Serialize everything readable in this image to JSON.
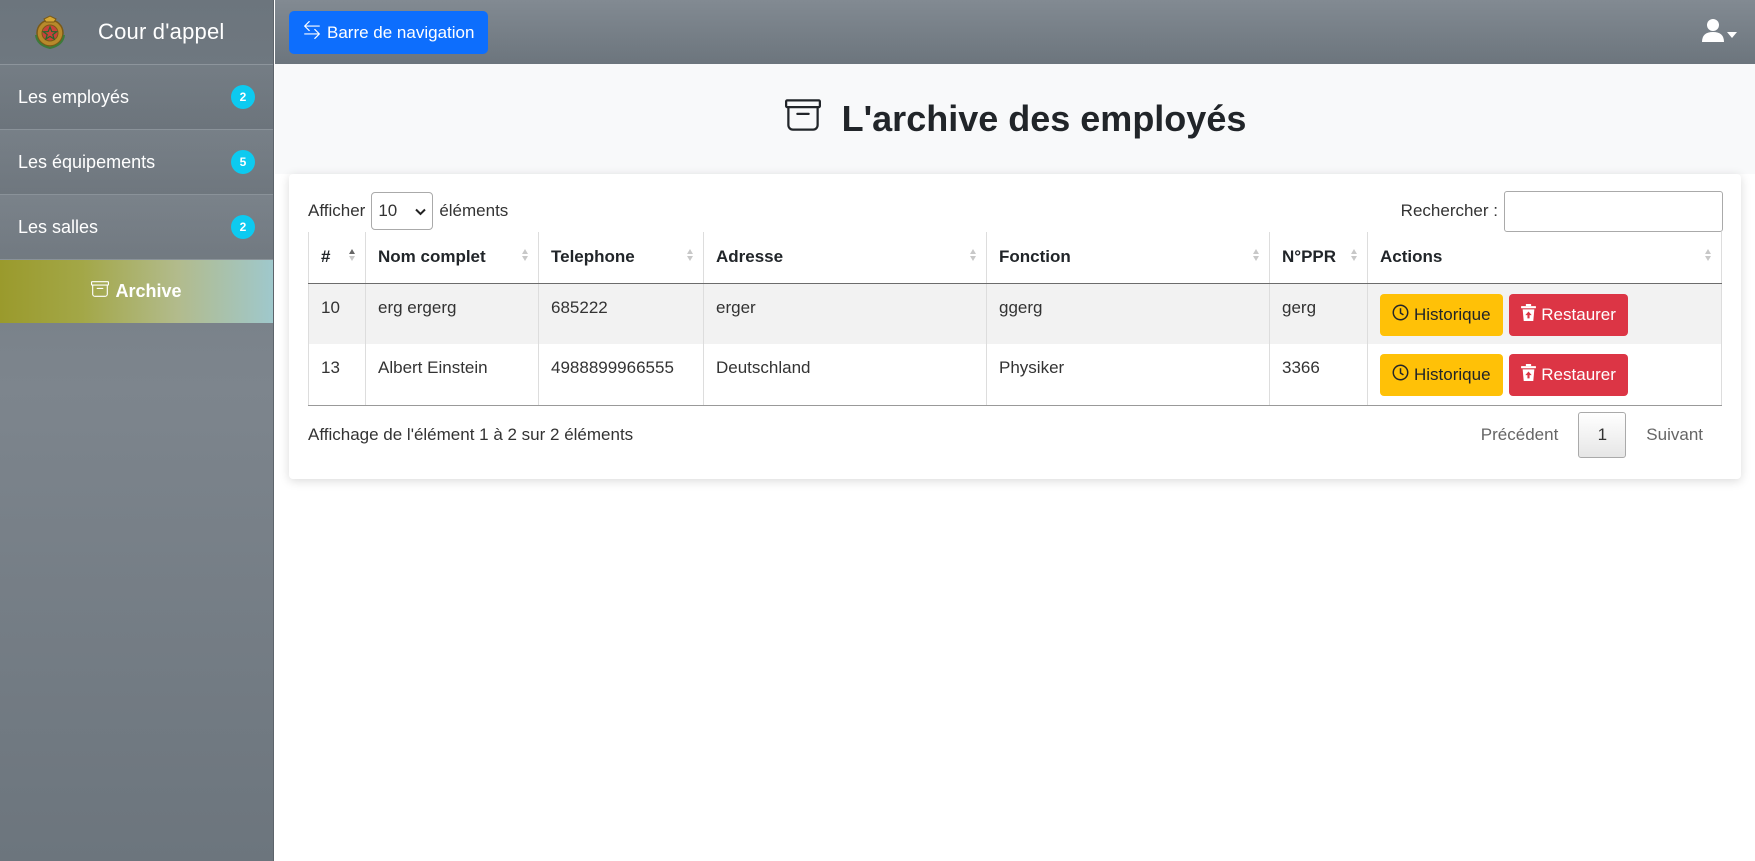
{
  "brand": {
    "title": "Cour d'appel",
    "logo_icon": "emblem-icon"
  },
  "sidebar": {
    "items": [
      {
        "label": "Les employés",
        "count": "2"
      },
      {
        "label": "Les équipements",
        "count": "5"
      },
      {
        "label": "Les salles",
        "count": "2"
      }
    ],
    "active": {
      "label": "Archive",
      "icon": "archive-icon"
    }
  },
  "topbar": {
    "toggle_label": "Barre de navigation",
    "toggle_icon": "arrows-swap-icon",
    "user_icon": "user-icon"
  },
  "page": {
    "title": "L'archive des employés"
  },
  "table_controls": {
    "show_label": "Afficher",
    "length_value": "10",
    "elements_label": "éléments",
    "search_label": "Rechercher :",
    "search_value": ""
  },
  "table": {
    "columns": [
      "#",
      "Nom complet",
      "Telephone",
      "Adresse",
      "Fonction",
      "N°PPR",
      "Actions"
    ],
    "rows": [
      {
        "id": "10",
        "name": "erg ergerg",
        "phone": "685222",
        "address": "erger",
        "function": "ggerg",
        "ppr": "gerg"
      },
      {
        "id": "13",
        "name": "Albert Einstein",
        "phone": "4988899966555",
        "address": "Deutschland",
        "function": "Physiker",
        "ppr": "3366"
      }
    ],
    "history_label": "Historique",
    "restore_label": "Restaurer"
  },
  "footer": {
    "info": "Affichage de l'élément 1 à 2 sur 2 éléments",
    "prev": "Précédent",
    "page": "1",
    "next": "Suivant"
  },
  "colors": {
    "primary": "#0d6efd",
    "warning": "#ffc107",
    "danger": "#dc3545",
    "badge": "#0dcaf0",
    "sidebar": "#6c757d"
  }
}
